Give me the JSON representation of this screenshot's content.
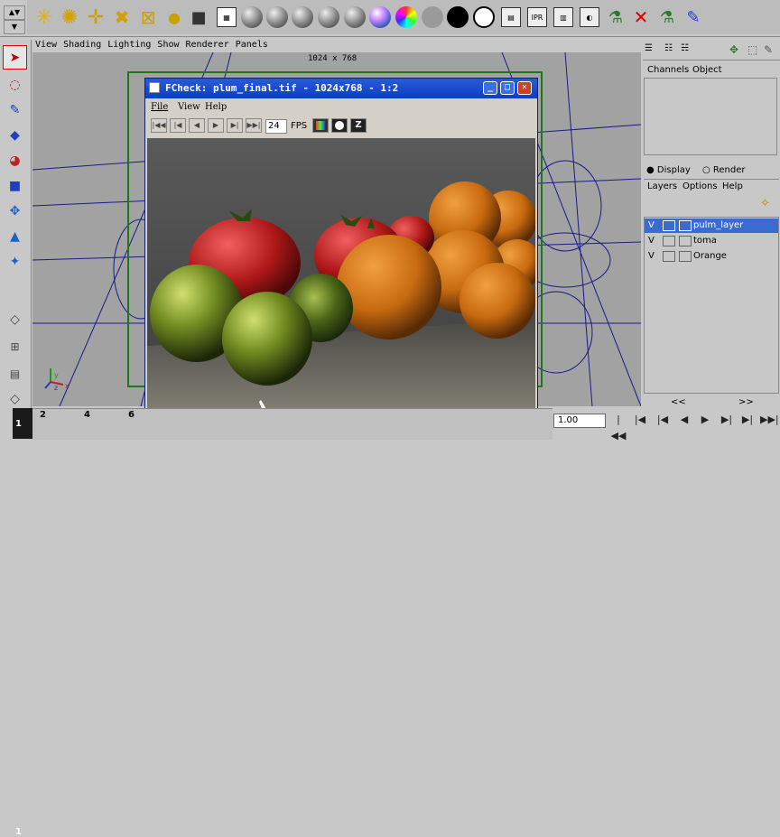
{
  "shelf": {
    "icons": [
      "sun-light-icon",
      "ambient-light-icon",
      "point-light-icon",
      "spot-light-icon",
      "area-light-icon",
      "volume-light-icon",
      "camera-icon",
      "hypershade-icon",
      "shader-sphere-gray-1-icon",
      "shader-sphere-gray-2-icon",
      "shader-sphere-gray-3-icon",
      "shader-sphere-gray-4-icon",
      "shader-sphere-rainbow-icon",
      "shader-sphere-color-icon",
      "shader-sphere-flat-icon",
      "shader-sphere-black-icon",
      "shader-sphere-white-icon",
      "render-icon",
      "ipr-render-icon",
      "render-settings-icon",
      "render-view-icon",
      "batch-render-icon",
      "disable-render-icon",
      "render-globals-icon",
      "paint-effects-icon"
    ],
    "accent_blue": "#2a5bd7"
  },
  "viewport": {
    "menu": [
      "View",
      "Shading",
      "Lighting",
      "Show",
      "Renderer",
      "Panels"
    ],
    "resolution": "1024 x 768"
  },
  "fcheck": {
    "title": "FCheck: plum_final.tif - 1024x768 - 1:2",
    "menu": [
      "File",
      "View",
      "Help"
    ],
    "fps_value": "24",
    "fps_label": "FPS",
    "z_label": "Z"
  },
  "channels": {
    "menu": [
      "Channels",
      "Object"
    ]
  },
  "layers": {
    "radio_display": "Display",
    "radio_render": "Render",
    "menu": [
      "Layers",
      "Options",
      "Help"
    ],
    "rows": [
      {
        "v": "V",
        "name": "pulm_layer",
        "selected": true
      },
      {
        "v": "V",
        "name": "toma",
        "selected": false
      },
      {
        "v": "V",
        "name": "Orange",
        "selected": false
      }
    ],
    "scroll_left": "<<",
    "scroll_right": ">>"
  },
  "timeline": {
    "ticks": [
      "2",
      "4",
      "6"
    ],
    "current_frame": "1",
    "frame_field": "1.00"
  }
}
